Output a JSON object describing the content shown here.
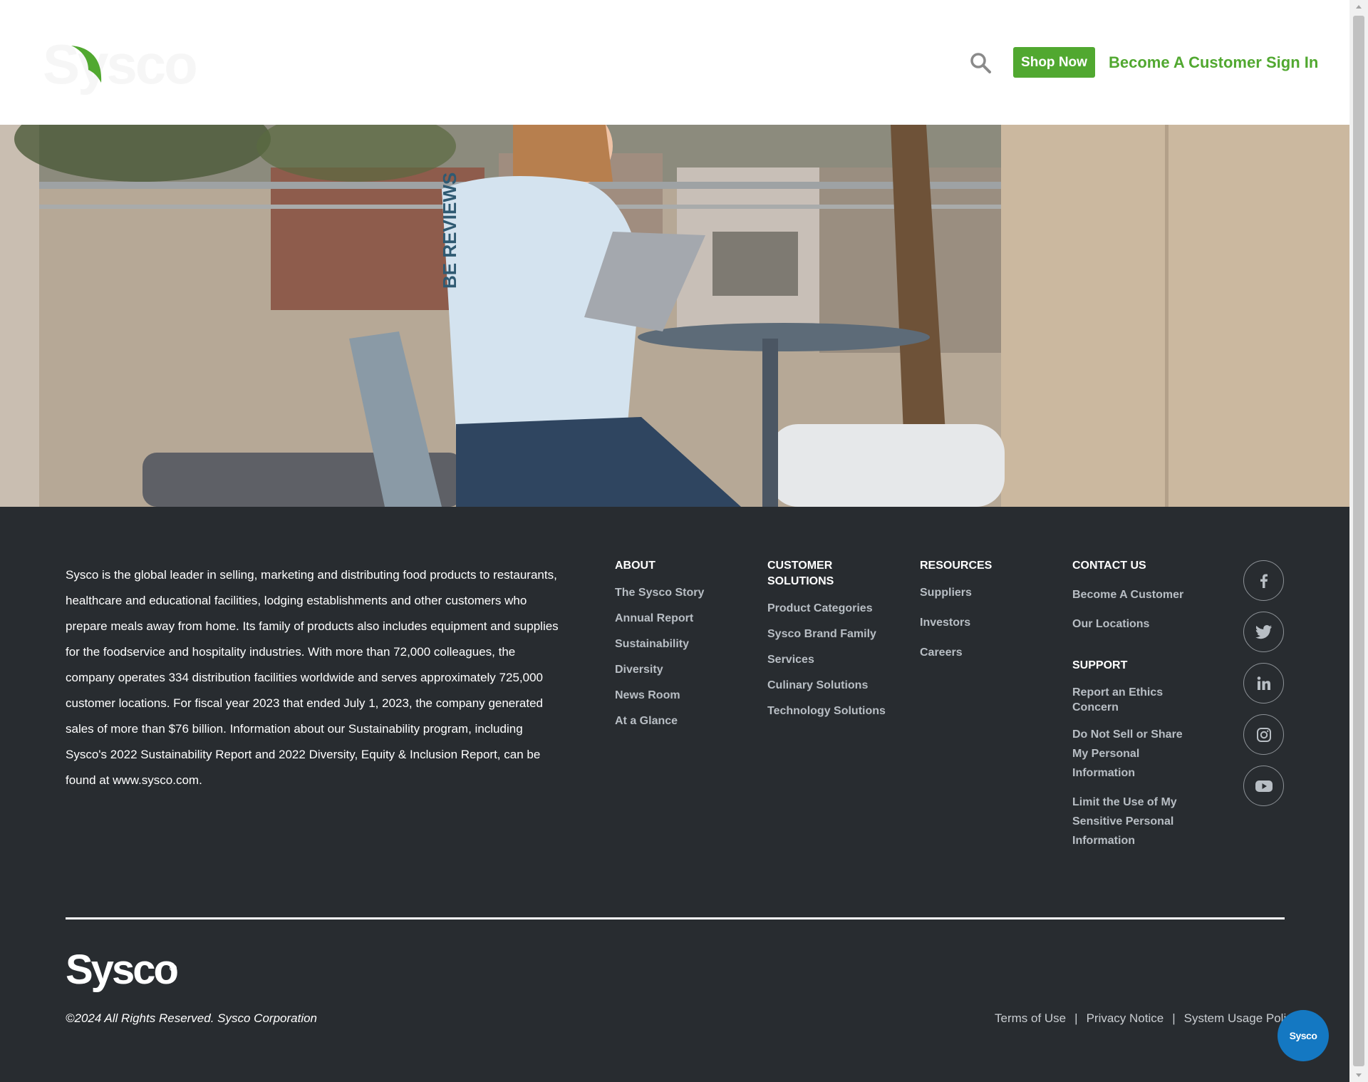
{
  "header": {
    "logo_text": "Sysco",
    "shop_now": "Shop Now",
    "become_customer": "Become A Customer",
    "sign_in": "Sign In"
  },
  "hero": {
    "sleeve_text": "BE REVIEWS"
  },
  "footer": {
    "about_text": "Sysco is the global leader in selling, marketing and distributing food products to restaurants, healthcare and educational facilities, lodging establishments and other customers who prepare meals away from home. Its family of products also includes equipment and supplies for the foodservice and hospitality industries. With more than 72,000 colleagues, the company operates 334 distribution facilities worldwide and serves approximately 725,000 customer locations. For fiscal year 2023 that ended July 1, 2023, the company generated sales of more than $76 billion. Information about our Sustainability program, including Sysco's 2022 Sustainability Report and 2022 Diversity, Equity & Inclusion Report, can be found at www.sysco.com.",
    "about": {
      "heading": "ABOUT",
      "links": [
        "The Sysco Story",
        "Annual Report",
        "Sustainability",
        "Diversity",
        "News Room",
        "At a Glance"
      ]
    },
    "customer_solutions": {
      "heading": "CUSTOMER SOLUTIONS",
      "links": [
        "Product Categories",
        "Sysco Brand Family",
        "Services",
        "Culinary Solutions",
        "Technology Solutions"
      ]
    },
    "resources": {
      "heading": "RESOURCES",
      "links": [
        "Suppliers",
        "Investors",
        "Careers"
      ]
    },
    "contact": {
      "heading": "CONTACT US",
      "links": [
        "Become A Customer",
        "Our Locations"
      ]
    },
    "support": {
      "heading": "SUPPORT",
      "links": [
        "Report an Ethics Concern",
        "Do Not Sell or Share My Personal Information",
        "Limit the Use of My Sensitive Personal Information"
      ]
    },
    "social_icons": [
      "facebook-icon",
      "twitter-icon",
      "linkedin-icon",
      "instagram-icon",
      "youtube-icon"
    ],
    "logo_text": "Sysco",
    "copyright": "©2024 All Rights Reserved. Sysco Corporation",
    "legal": {
      "terms": "Terms of Use",
      "privacy": "Privacy Notice",
      "usage": "System Usage Policy",
      "separator": "|"
    }
  },
  "chat": {
    "label": "Sysco"
  },
  "colors": {
    "brand_green": "#51a830",
    "footer_bg": "#282c30",
    "chat_blue": "#1478c2"
  }
}
